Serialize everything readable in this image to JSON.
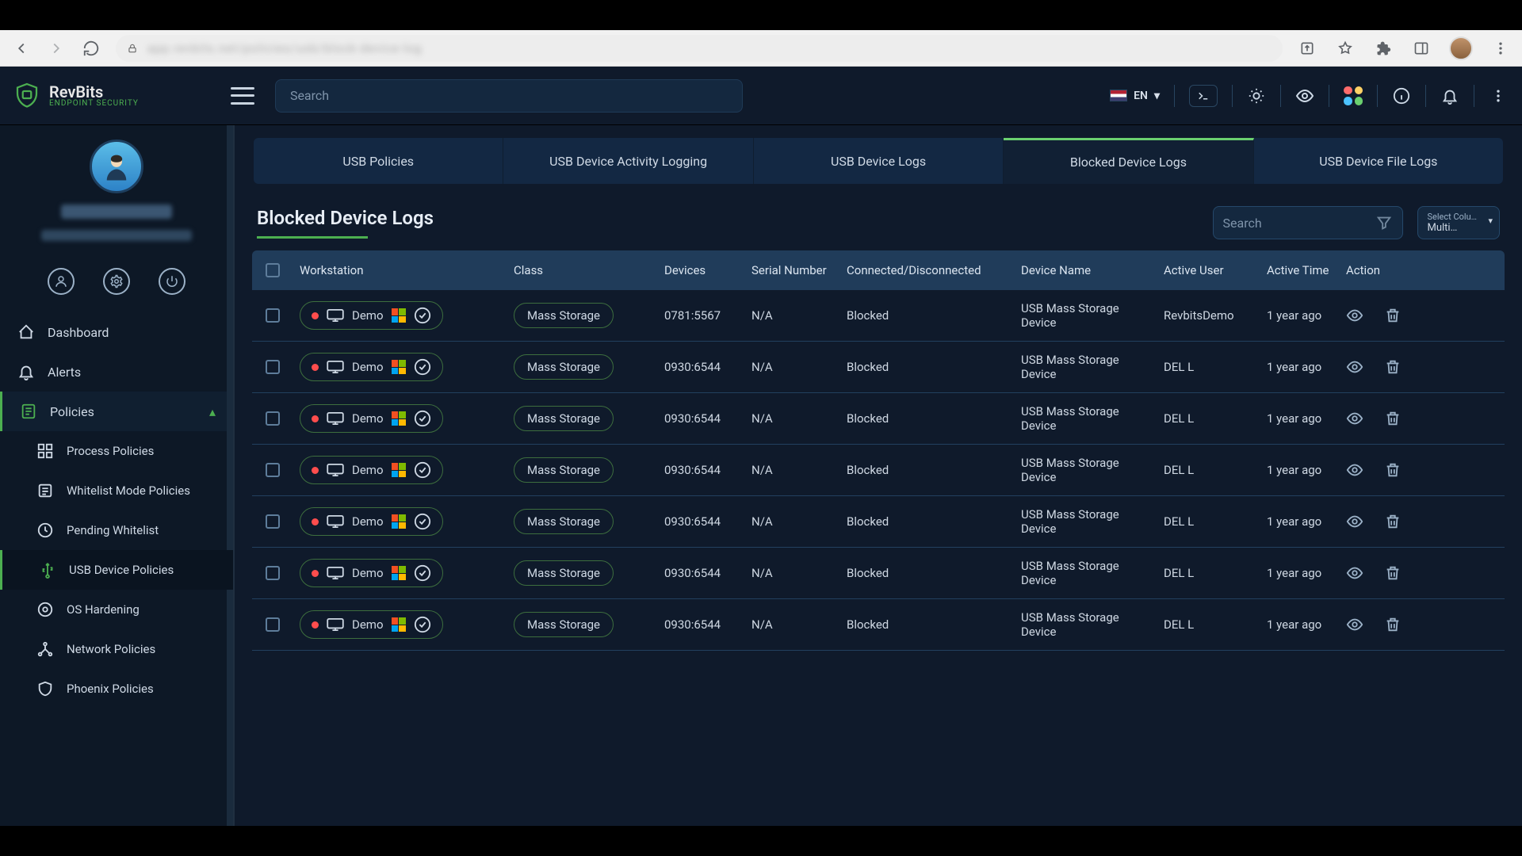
{
  "browser": {
    "addr_blur": "app.revbits.net/policies/usb/block-device-log"
  },
  "brand": {
    "name": "RevBits",
    "sub": "ENDPOINT SECURITY"
  },
  "top_search": {
    "placeholder": "Search"
  },
  "lang": {
    "code": "EN"
  },
  "sidebar": {
    "items": [
      {
        "label": "Dashboard"
      },
      {
        "label": "Alerts"
      },
      {
        "label": "Policies"
      },
      {
        "label": "Process Policies"
      },
      {
        "label": "Whitelist Mode Policies"
      },
      {
        "label": "Pending Whitelist"
      },
      {
        "label": "USB Device Policies"
      },
      {
        "label": "OS Hardening"
      },
      {
        "label": "Network Policies"
      },
      {
        "label": "Phoenix Policies"
      }
    ]
  },
  "tabs": {
    "items": [
      {
        "label": "USB Policies"
      },
      {
        "label": "USB Device Activity Logging"
      },
      {
        "label": "USB Device Logs"
      },
      {
        "label": "Blocked Device Logs"
      },
      {
        "label": "USB Device File Logs"
      }
    ],
    "activeIndex": 3
  },
  "page": {
    "title": "Blocked Device Logs"
  },
  "table_search": {
    "placeholder": "Search"
  },
  "colselect": {
    "l1": "Select Colu…",
    "l2": "Multi…"
  },
  "columns": {
    "workstation": "Workstation",
    "class": "Class",
    "devices": "Devices",
    "serial": "Serial Number",
    "conn": "Connected/Disconnected",
    "devname": "Device Name",
    "user": "Active User",
    "time": "Active Time",
    "action": "Action"
  },
  "rows": [
    {
      "ws": "Demo",
      "class": "Mass Storage",
      "devices": "0781:5567",
      "serial": "N/A",
      "conn": "Blocked",
      "devname": "USB Mass Storage Device",
      "user": "RevbitsDemo",
      "time": "1 year ago"
    },
    {
      "ws": "Demo",
      "class": "Mass Storage",
      "devices": "0930:6544",
      "serial": "N/A",
      "conn": "Blocked",
      "devname": "USB Mass Storage Device",
      "user": "DEL L",
      "time": "1 year ago"
    },
    {
      "ws": "Demo",
      "class": "Mass Storage",
      "devices": "0930:6544",
      "serial": "N/A",
      "conn": "Blocked",
      "devname": "USB Mass Storage Device",
      "user": "DEL L",
      "time": "1 year ago"
    },
    {
      "ws": "Demo",
      "class": "Mass Storage",
      "devices": "0930:6544",
      "serial": "N/A",
      "conn": "Blocked",
      "devname": "USB Mass Storage Device",
      "user": "DEL L",
      "time": "1 year ago"
    },
    {
      "ws": "Demo",
      "class": "Mass Storage",
      "devices": "0930:6544",
      "serial": "N/A",
      "conn": "Blocked",
      "devname": "USB Mass Storage Device",
      "user": "DEL L",
      "time": "1 year ago"
    },
    {
      "ws": "Demo",
      "class": "Mass Storage",
      "devices": "0930:6544",
      "serial": "N/A",
      "conn": "Blocked",
      "devname": "USB Mass Storage Device",
      "user": "DEL L",
      "time": "1 year ago"
    },
    {
      "ws": "Demo",
      "class": "Mass Storage",
      "devices": "0930:6544",
      "serial": "N/A",
      "conn": "Blocked",
      "devname": "USB Mass Storage Device",
      "user": "DEL L",
      "time": "1 year ago"
    }
  ]
}
